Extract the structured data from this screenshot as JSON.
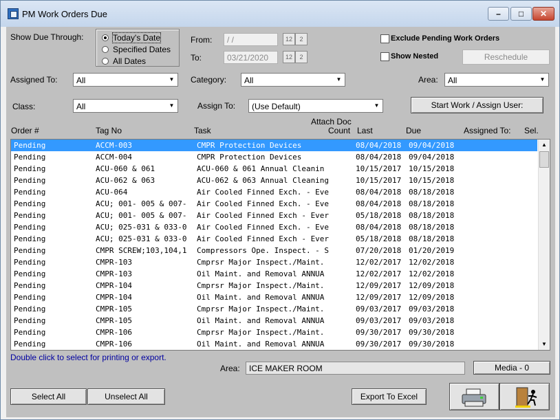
{
  "window": {
    "title": "PM Work Orders Due"
  },
  "filters": {
    "show_due_label": "Show Due Through:",
    "radio_options": [
      "Today's Date",
      "Specified Dates",
      "All Dates"
    ],
    "selected_radio": 0,
    "from_label": "From:",
    "from_value": " / /",
    "to_label": "To:",
    "to_value": "03/21/2020",
    "exclude_pending_label": "Exclude Pending Work Orders",
    "show_nested_label": "Show Nested",
    "reschedule_label": "Reschedule",
    "assigned_to_label": "Assigned To:",
    "assigned_to_value": "All",
    "category_label": "Category:",
    "category_value": "All",
    "area_label": "Area:",
    "area_value": "All",
    "class_label": "Class:",
    "class_value": "All",
    "assign_to_label": "Assign To:",
    "assign_to_value": "(Use Default)",
    "start_work_label": "Start Work / Assign User:"
  },
  "list": {
    "headers": {
      "order": "Order #",
      "tag": "Tag No",
      "task": "Task",
      "attach_doc": "Attach Doc",
      "count": "Count",
      "last": "Last",
      "due": "Due",
      "assigned": "Assigned To:",
      "sel": "Sel."
    },
    "selected_index": 0,
    "rows": [
      {
        "order": "Pending",
        "tag": "ACCM-003",
        "task": "CMPR Protection Devices",
        "last": "08/04/2018",
        "due": "09/04/2018"
      },
      {
        "order": "Pending",
        "tag": "ACCM-004",
        "task": "CMPR Protection Devices",
        "last": "08/04/2018",
        "due": "09/04/2018"
      },
      {
        "order": "Pending",
        "tag": "ACU-060 & 061",
        "task": " ACU-060 & 061 Annual Cleanin",
        "last": "10/15/2017",
        "due": "10/15/2018"
      },
      {
        "order": "Pending",
        "tag": "ACU-062 & 063",
        "task": "ACU-062 & 063 Annual Cleaning",
        "last": "10/15/2017",
        "due": "10/15/2018"
      },
      {
        "order": "Pending",
        "tag": "ACU-064",
        "task": "Air Cooled Finned Exch. - Eve",
        "last": "08/04/2018",
        "due": "08/18/2018"
      },
      {
        "order": "Pending",
        "tag": "ACU; 001- 005 & 007-",
        "task": "Air Cooled Finned Exch. - Eve",
        "last": "08/04/2018",
        "due": "08/18/2018"
      },
      {
        "order": "Pending",
        "tag": "ACU; 001- 005 & 007-",
        "task": "Air Cooled Finned Exch - Ever",
        "last": "05/18/2018",
        "due": "08/18/2018"
      },
      {
        "order": "Pending",
        "tag": "ACU; 025-031 & 033-0",
        "task": "Air Cooled Finned Exch. - Eve",
        "last": "08/04/2018",
        "due": "08/18/2018"
      },
      {
        "order": "Pending",
        "tag": "ACU; 025-031 & 033-0",
        "task": "Air Cooled Finned Exch - Ever",
        "last": "05/18/2018",
        "due": "08/18/2018"
      },
      {
        "order": "Pending",
        "tag": "CMPR SCREW;103,104,1",
        "task": "Compressors Ope. Inspect. - S",
        "last": "07/20/2018",
        "due": "01/20/2019"
      },
      {
        "order": "Pending",
        "tag": "CMPR-103",
        "task": "Cmprsr Major Inspect./Maint.",
        "last": "12/02/2017",
        "due": "12/02/2018"
      },
      {
        "order": "Pending",
        "tag": "CMPR-103",
        "task": "Oil Maint. and Removal  ANNUA",
        "last": "12/02/2017",
        "due": "12/02/2018"
      },
      {
        "order": "Pending",
        "tag": "CMPR-104",
        "task": "Cmprsr Major Inspect./Maint.",
        "last": "12/09/2017",
        "due": "12/09/2018"
      },
      {
        "order": "Pending",
        "tag": "CMPR-104",
        "task": "Oil Maint. and Removal  ANNUA",
        "last": "12/09/2017",
        "due": "12/09/2018"
      },
      {
        "order": "Pending",
        "tag": "CMPR-105",
        "task": "Cmprsr Major Inspect./Maint.",
        "last": "09/03/2017",
        "due": "09/03/2018"
      },
      {
        "order": "Pending",
        "tag": "CMPR-105",
        "task": "Oil Maint. and Removal  ANNUA",
        "last": "09/03/2017",
        "due": "09/03/2018"
      },
      {
        "order": "Pending",
        "tag": "CMPR-106",
        "task": "Cmprsr Major Inspect./Maint.",
        "last": "09/30/2017",
        "due": "09/30/2018"
      },
      {
        "order": "Pending",
        "tag": "CMPR-106",
        "task": "Oil Maint. and Removal  ANNUA",
        "last": "09/30/2017",
        "due": "09/30/2018"
      }
    ]
  },
  "footer": {
    "hint": "Double click to select for printing or export.",
    "area_label": "Area:",
    "area_value": "ICE MAKER ROOM",
    "media_label": "Media - 0",
    "select_all": "Select All",
    "unselect_all": "Unselect All",
    "export_excel": "Export To Excel"
  },
  "icons": {
    "print": "printer-icon",
    "exit": "exit-door-icon"
  }
}
